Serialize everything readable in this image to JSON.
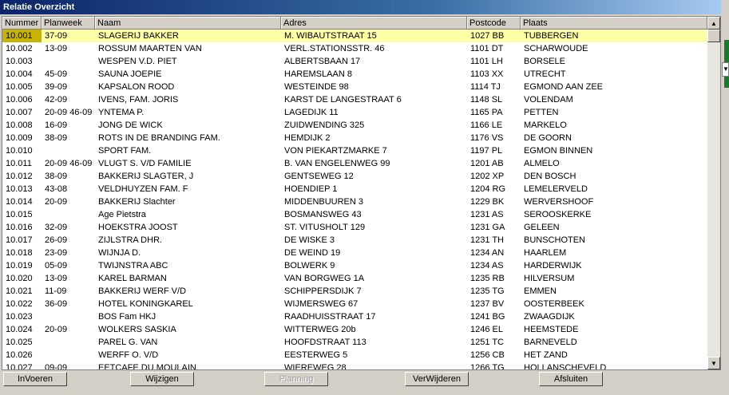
{
  "window": {
    "title": "Relatie Overzicht"
  },
  "table": {
    "columns": [
      "Nummer",
      "Planweek",
      "Naam",
      "Adres",
      "Postcode",
      "Plaats"
    ],
    "selected_row": 0,
    "rows": [
      [
        "10.001",
        "37-09",
        "SLAGERIJ BAKKER",
        "M. WIBAUTSTRAAT 15",
        "1027 BB",
        "TUBBERGEN"
      ],
      [
        "10.002",
        "13-09",
        "ROSSUM MAARTEN VAN",
        "VERL.STATIONSSTR. 46",
        "1101 DT",
        "SCHARWOUDE"
      ],
      [
        "10.003",
        "",
        "WESPEN V.D. PIET",
        "ALBERTSBAAN 17",
        "1101 LH",
        "BORSELE"
      ],
      [
        "10.004",
        "45-09",
        "SAUNA JOEPIE",
        "HAREMSLAAN 8",
        "1103 XX",
        "UTRECHT"
      ],
      [
        "10.005",
        "39-09",
        "KAPSALON ROOD",
        "WESTEINDE 98",
        "1114 TJ",
        "EGMOND AAN ZEE"
      ],
      [
        "10.006",
        "42-09",
        "IVENS, FAM. JORIS",
        "KARST DE LANGESTRAAT 6",
        "1148 SL",
        "VOLENDAM"
      ],
      [
        "10.007",
        "20-09 46-09",
        "YNTEMA P.",
        "LAGEDIJK 11",
        "1165 PA",
        "PETTEN"
      ],
      [
        "10.008",
        "16-09",
        "JONG DE  WICK",
        "ZUIDWENDING 325",
        "1166 LE",
        "MARKELO"
      ],
      [
        "10.009",
        "38-09",
        "ROTS IN DE BRANDING FAM.",
        "HEMDIJK 2",
        "1176 VS",
        "DE GOORN"
      ],
      [
        "10.010",
        "",
        "SPORT FAM.",
        "VON PIEKARTZMARKE 7",
        "1197 PL",
        "EGMON BINNEN"
      ],
      [
        "10.011",
        "20-09 46-09",
        "VLUGT S. V/D FAMILIE",
        "B. VAN ENGELENWEG 99",
        "1201 AB",
        "ALMELO"
      ],
      [
        "10.012",
        "38-09",
        "BAKKERIJ SLAGTER, J",
        "GENTSEWEG 12",
        "1202 XP",
        "DEN BOSCH"
      ],
      [
        "10.013",
        "43-08",
        "VELDHUYZEN FAM. F",
        "HOENDIEP 1",
        "1204 RG",
        "LEMELERVELD"
      ],
      [
        "10.014",
        "20-09",
        "BAKKERIJ Slachter",
        "MIDDENBUUREN 3",
        "1229 BK",
        "WERVERSHOOF"
      ],
      [
        "10.015",
        "",
        "Age Pietstra",
        "BOSMANSWEG 43",
        "1231 AS",
        "SEROOSKERKE"
      ],
      [
        "10.016",
        "32-09",
        "HOEKSTRA JOOST",
        "ST. VITUSHOLT 129",
        "1231 GA",
        "GELEEN"
      ],
      [
        "10.017",
        "26-09",
        "ZIJLSTRA DHR.",
        "DE WISKE 3",
        "1231 TH",
        "BUNSCHOTEN"
      ],
      [
        "10.018",
        "23-09",
        "WIJNJA D.",
        "DE WEIND 19",
        "1234 AN",
        "HAARLEM"
      ],
      [
        "10.019",
        "05-09",
        "TWIJNSTRA ABC",
        "BOLWERK 9",
        "1234 AS",
        "HARDERWIJK"
      ],
      [
        "10.020",
        "13-09",
        "KAREL BARMAN",
        "VAN BORGWEG 1A",
        "1235 RB",
        "HILVERSUM"
      ],
      [
        "10.021",
        "11-09",
        "BAKKERIJ WERF V/D",
        "SCHIPPERSDIJK 7",
        "1235 TG",
        "EMMEN"
      ],
      [
        "10.022",
        "36-09",
        "HOTEL KONINGKAREL",
        "WIJMERSWEG 67",
        "1237 BV",
        "OOSTERBEEK"
      ],
      [
        "10.023",
        "",
        "BOS Fam HKJ",
        "RAADHUISSTRAAT 17",
        "1241 BG",
        "ZWAAGDIJK"
      ],
      [
        "10.024",
        "20-09",
        "WOLKERS SASKIA",
        "WITTERWEG 20b",
        "1246 EL",
        "HEEMSTEDE"
      ],
      [
        "10.025",
        "",
        "PAREL G. VAN",
        "HOOFDSTRAAT 113",
        "1251 TC",
        "BARNEVELD"
      ],
      [
        "10.026",
        "",
        "WERFF O. V/D",
        "EESTERWEG 5",
        "1256 CB",
        "HET ZAND"
      ],
      [
        "10.027",
        "09-09",
        "EETCAFE DU MOULAIN",
        "WIEREWEG 28",
        "1266 TG",
        "HOLLANSCHEVELD"
      ]
    ]
  },
  "buttons": {
    "invoeren": "InVoeren",
    "wijzigen": "Wijzigen",
    "planning": "Planning",
    "verwijderen": "VerWijderen",
    "afsluiten": "Afsluiten"
  },
  "scrollbar": {
    "up_icon": "scroll-up-arrow",
    "down_icon": "scroll-down-arrow"
  }
}
